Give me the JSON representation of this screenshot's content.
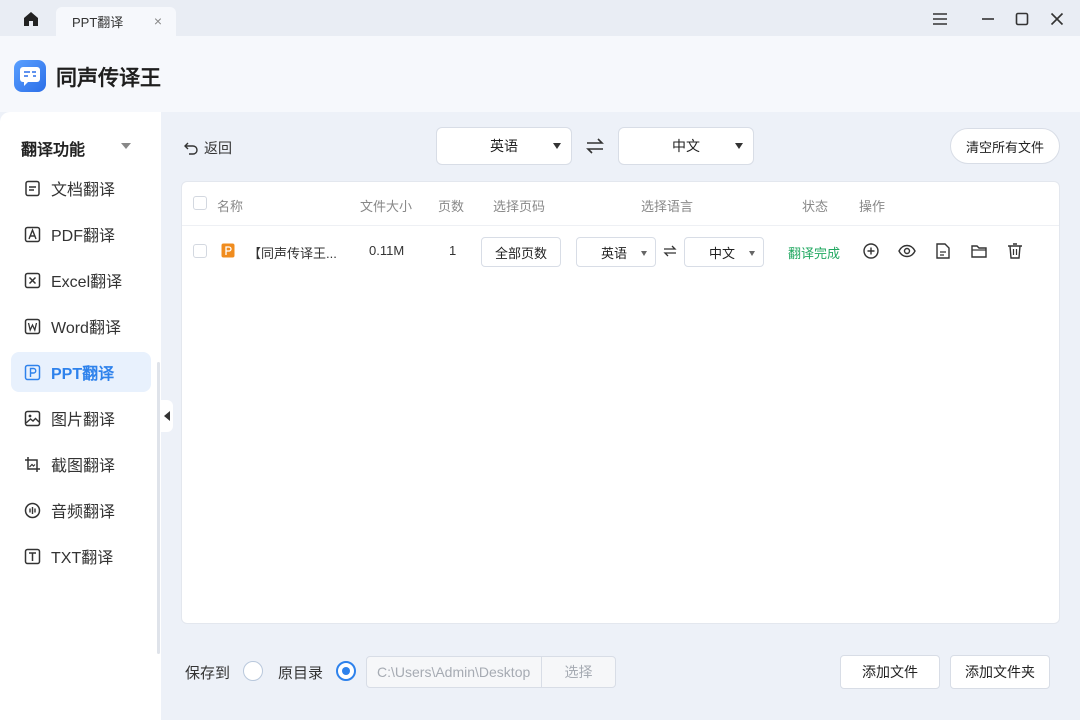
{
  "titlebar": {
    "tab_label": "PPT翻译",
    "tab_close": "×"
  },
  "app": {
    "title": "同声传译王"
  },
  "sidebar": {
    "header": "翻译功能",
    "items": [
      {
        "label": "文档翻译",
        "icon": "document-icon"
      },
      {
        "label": "PDF翻译",
        "icon": "pdf-icon"
      },
      {
        "label": "Excel翻译",
        "icon": "excel-icon"
      },
      {
        "label": "Word翻译",
        "icon": "word-icon"
      },
      {
        "label": "PPT翻译",
        "icon": "ppt-icon",
        "active": true
      },
      {
        "label": "图片翻译",
        "icon": "image-icon"
      },
      {
        "label": "截图翻译",
        "icon": "screenshot-icon"
      },
      {
        "label": "音频翻译",
        "icon": "audio-icon"
      },
      {
        "label": "TXT翻译",
        "icon": "txt-icon"
      }
    ]
  },
  "toolbar": {
    "back_label": "返回",
    "source_lang": "英语",
    "target_lang": "中文",
    "clear_label": "清空所有文件"
  },
  "table": {
    "headers": {
      "name": "名称",
      "size": "文件大小",
      "pages": "页数",
      "page_range": "选择页码",
      "language": "选择语言",
      "status": "状态",
      "actions": "操作"
    },
    "rows": [
      {
        "name": "【同声传译王...",
        "size": "0.11M",
        "pages": "1",
        "page_range": "全部页数",
        "source_lang": "英语",
        "target_lang": "中文",
        "status": "翻译完成"
      }
    ]
  },
  "footer": {
    "save_to_label": "保存到",
    "original_dir_label": "原目录",
    "path_value": "C:\\Users\\Admin\\Desktop",
    "choose_label": "选择",
    "add_file_label": "添加文件",
    "add_folder_label": "添加文件夹"
  },
  "colors": {
    "accent": "#2e82ec",
    "status_done": "#22a861",
    "ppt_icon": "#f08c1e"
  }
}
